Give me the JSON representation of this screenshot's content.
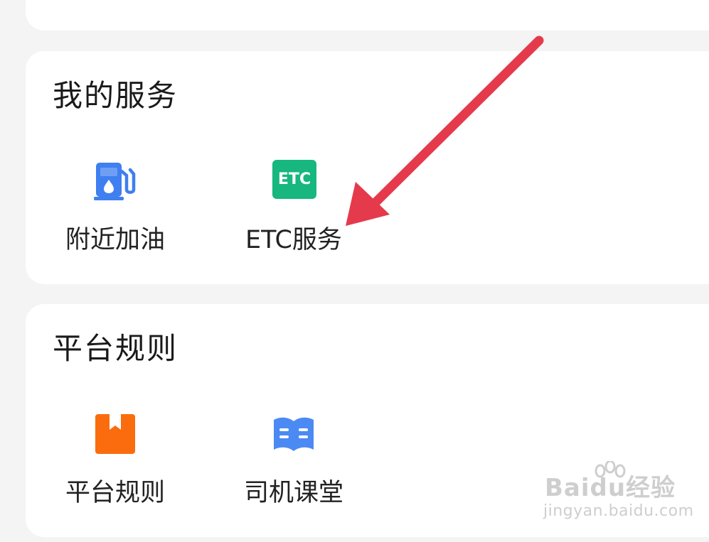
{
  "sections": {
    "services": {
      "title": "我的服务",
      "items": [
        {
          "label": "附近加油",
          "icon": "fuel-station-icon"
        },
        {
          "label": "ETC服务",
          "icon": "etc-icon",
          "icon_text": "ETC"
        }
      ]
    },
    "rules": {
      "title": "平台规则",
      "items": [
        {
          "label": "平台规则",
          "icon": "rulebook-icon"
        },
        {
          "label": "司机课堂",
          "icon": "open-book-icon"
        }
      ]
    }
  },
  "annotation": {
    "arrow_color": "#e53a4b",
    "arrow_target": "ETC服务"
  },
  "watermark": {
    "brand": "Baidu经验",
    "url": "jingyan.baidu.com"
  },
  "colors": {
    "background": "#f4f4f4",
    "card": "#ffffff",
    "fuel_icon": "#3f7ff0",
    "etc_icon": "#17b77f",
    "rules_icon": "#fb6c0e",
    "classroom_icon": "#4c8af3"
  }
}
